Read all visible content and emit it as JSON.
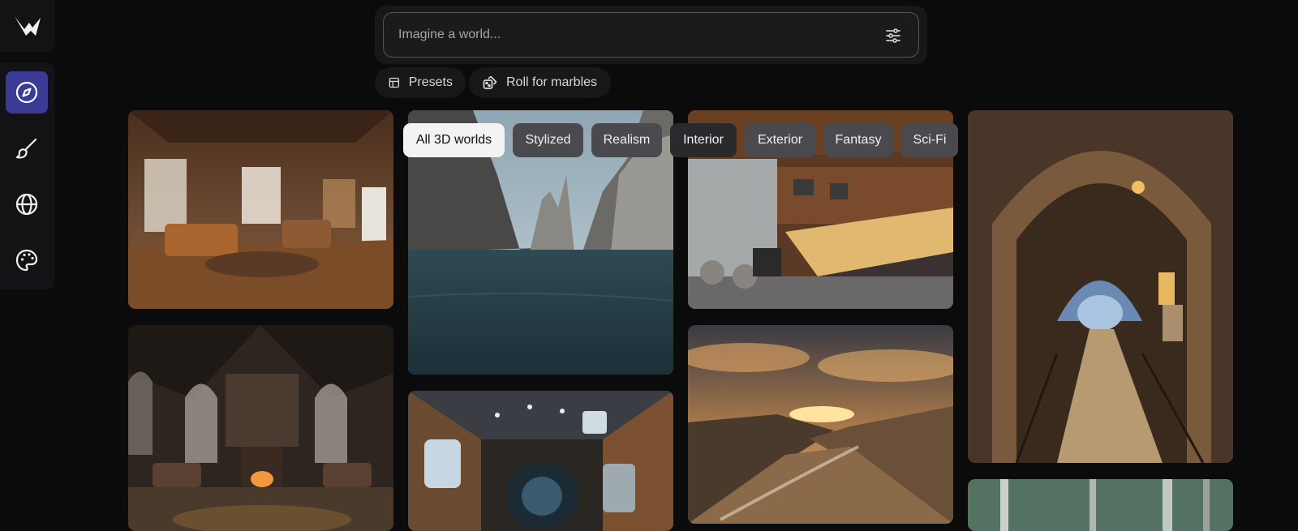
{
  "search": {
    "placeholder": "Imagine a world..."
  },
  "actions": {
    "presets_label": "Presets",
    "roll_label": "Roll for marbles"
  },
  "filters": [
    {
      "label": "All 3D worlds",
      "active": true
    },
    {
      "label": "Stylized",
      "active": false
    },
    {
      "label": "Realism",
      "active": false
    },
    {
      "label": "Interior",
      "active": false
    },
    {
      "label": "Exterior",
      "active": false
    },
    {
      "label": "Fantasy",
      "active": false
    },
    {
      "label": "Sci-Fi",
      "active": false
    }
  ],
  "nav": {
    "items": [
      {
        "icon": "compass-icon",
        "active": true
      },
      {
        "icon": "brush-icon",
        "active": false
      },
      {
        "icon": "globe-icon",
        "active": false
      },
      {
        "icon": "palette-icon",
        "active": false
      }
    ]
  },
  "colors": {
    "accent": "#3b3a96",
    "background": "#0b0b0c",
    "panel": "#131315"
  }
}
